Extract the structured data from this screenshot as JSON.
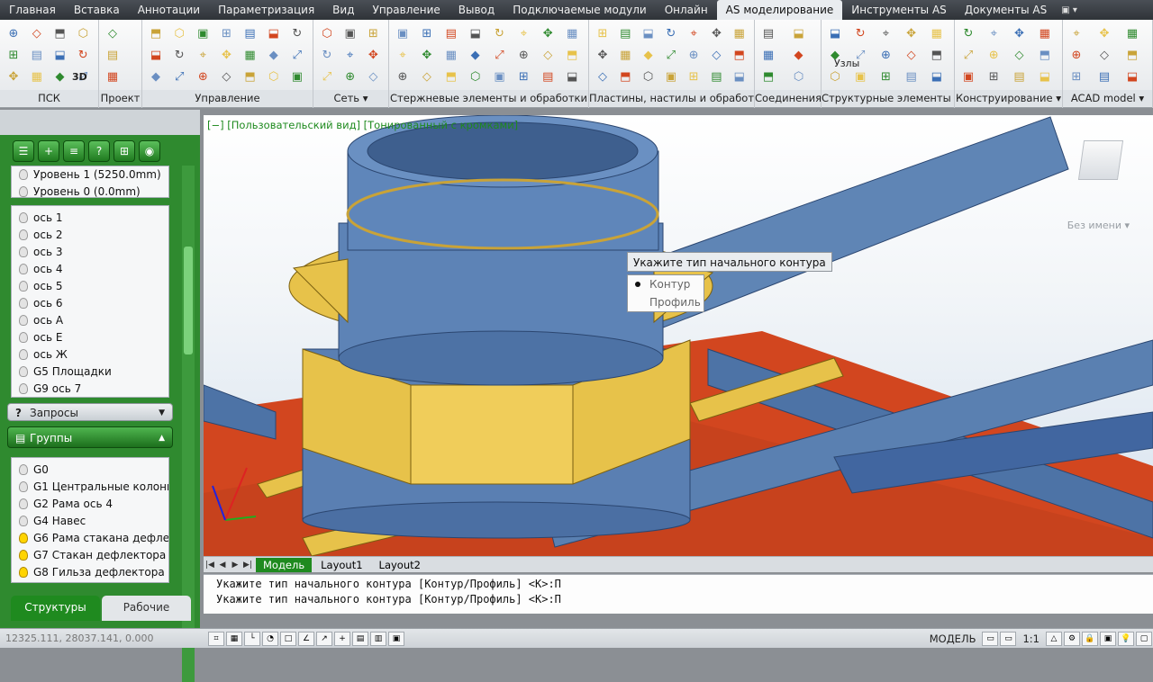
{
  "menu": {
    "tabs": [
      "Главная",
      "Вставка",
      "Аннотации",
      "Параметризация",
      "Вид",
      "Управление",
      "Вывод",
      "Подключаемые модули",
      "Онлайн",
      "AS моделирование",
      "Инструменты AS",
      "Документы AS"
    ],
    "active_index": 9
  },
  "ribbon": {
    "panels": [
      {
        "title": "ПСК"
      },
      {
        "title": "Проект"
      },
      {
        "title": "Управление"
      },
      {
        "title": "Сеть ▾"
      },
      {
        "title": "Стержневые элементы и обработки"
      },
      {
        "title": "Пластины, настилы и обработки"
      },
      {
        "title": "Соединения"
      },
      {
        "title": "Структурные элементы ▾"
      },
      {
        "title": "Конструирование ▾"
      },
      {
        "title": "ACAD model ▾"
      }
    ],
    "nodes_label": "Узлы",
    "view3d_label": "3D"
  },
  "left_panel": {
    "levels": [
      "Уровень 1 (5250.0mm)",
      "Уровень 0 (0.0mm)"
    ],
    "axes": [
      "ось 1",
      "ось 2",
      "ось 3",
      "ось 4",
      "ось 5",
      "ось 6",
      "ось А",
      "ось Е",
      "ось Ж",
      "G5 Площадки",
      "G9 ось 7"
    ],
    "queries_label": "Запросы",
    "groups_label": "Группы",
    "groups": [
      {
        "label": "G0",
        "on": false
      },
      {
        "label": "G1 Центральные колонн",
        "on": false
      },
      {
        "label": "G2 Рама ось 4",
        "on": false
      },
      {
        "label": "G4 Навес",
        "on": false
      },
      {
        "label": "G6 Рама стакана дефле",
        "on": true
      },
      {
        "label": "G7 Стакан дефлектора",
        "on": true
      },
      {
        "label": "G8 Гильза дефлектора",
        "on": true
      }
    ],
    "tab_structures": "Структуры",
    "tab_workplanes": "Рабочие плоско"
  },
  "viewport": {
    "label": "[−] [Пользовательский вид] [Тонированный с кромками]",
    "named_view": "Без имени ▾",
    "prompt_tooltip": "Укажите тип начального контура",
    "options": [
      "Контур",
      "Профиль"
    ],
    "selected_option": 0
  },
  "layout_tabs": [
    "Модель",
    "Layout1",
    "Layout2"
  ],
  "command_lines": [
    "Укажите тип начального контура [Контур/Профиль] <К>:П",
    "Укажите тип начального контура [Контур/Профиль] <К>:П"
  ],
  "status": {
    "coords": "12325.111, 28037.141, 0.000",
    "model_label": "МОДЕЛЬ",
    "scale": "1:1"
  },
  "colors": {
    "accent_green": "#2f8a2f",
    "steel_blue": "#5f85b5",
    "brick_red": "#d2461f",
    "gold": "#e7c24a"
  }
}
